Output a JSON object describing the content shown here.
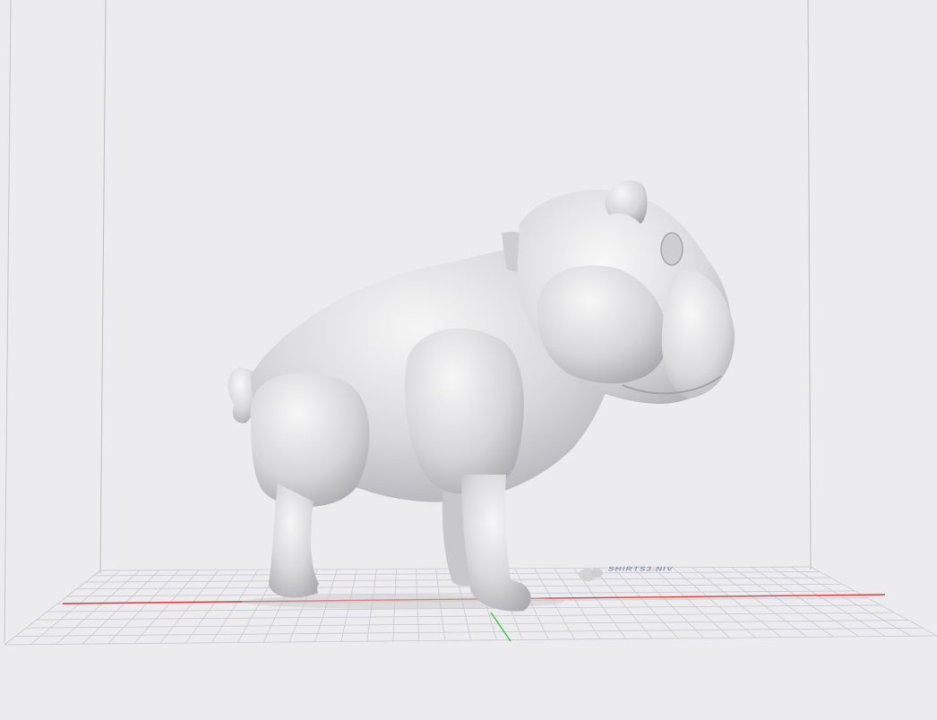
{
  "viewport": {
    "background": "#ececee",
    "wall_line_color": "#bdbdc2",
    "grid_line_color": "#c9c9ce",
    "x_axis_color": "#e03a3a",
    "y_axis_color": "#35c935",
    "model_color": "#d8d8da"
  },
  "model": {
    "name": "bulldog-figurine",
    "icon": "bulldog-model"
  },
  "bed": {
    "watermark_text": "SHIRTS3.NIV",
    "watermark_color": "#6a7ea0"
  }
}
